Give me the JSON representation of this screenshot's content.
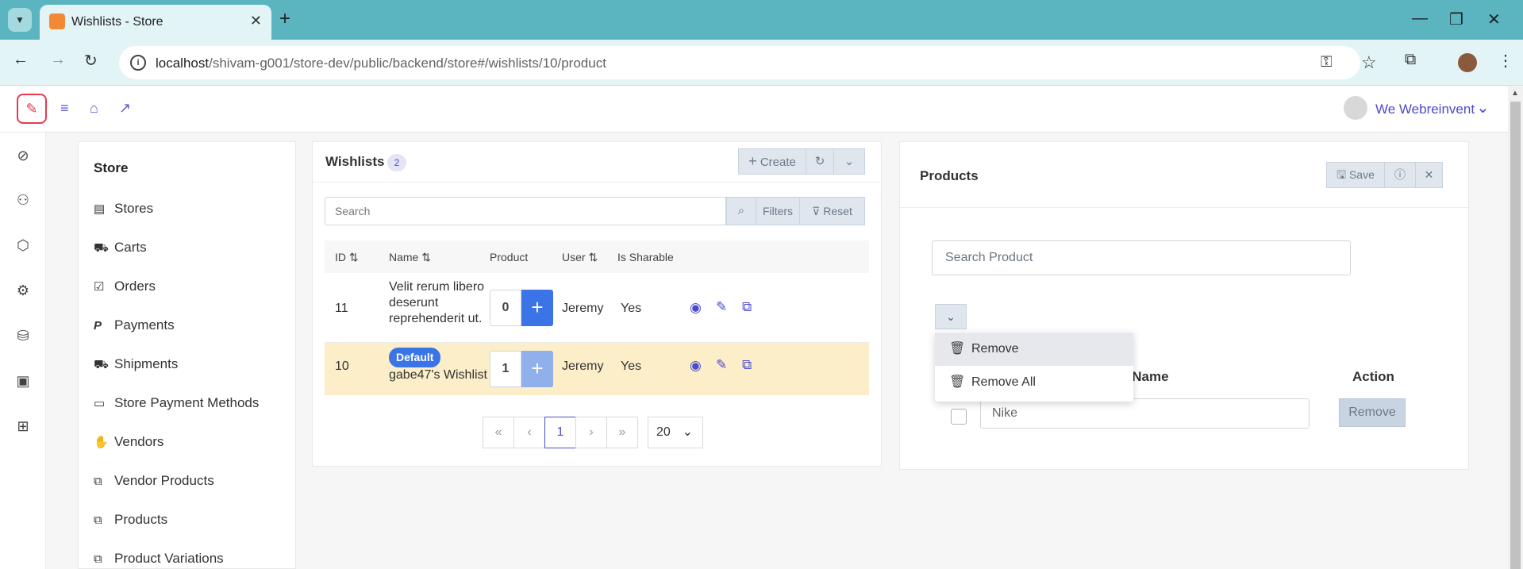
{
  "browser": {
    "tab_title": "Wishlists - Store",
    "url_host": "localhost",
    "url_path": "/shivam-g001/store-dev/public/backend/store#/wishlists/10/product"
  },
  "header": {
    "user_name": "We Webreinvent"
  },
  "store_nav": {
    "title": "Store",
    "items": [
      {
        "label": "Stores",
        "icon": "building-icon"
      },
      {
        "label": "Carts",
        "icon": "cart-icon"
      },
      {
        "label": "Orders",
        "icon": "checkbox-icon"
      },
      {
        "label": "Payments",
        "icon": "paypal-icon"
      },
      {
        "label": "Shipments",
        "icon": "truck-icon"
      },
      {
        "label": "Store Payment Methods",
        "icon": "credit-card-icon"
      },
      {
        "label": "Vendors",
        "icon": "handshake-icon"
      },
      {
        "label": "Vendor Products",
        "icon": "copy-icon"
      },
      {
        "label": "Products",
        "icon": "copy-icon"
      },
      {
        "label": "Product Variations",
        "icon": "copy-icon"
      }
    ]
  },
  "wishlists": {
    "title": "Wishlists",
    "count": "2",
    "create_label": "Create",
    "search_placeholder": "Search",
    "filters_label": "Filters",
    "reset_label": "Reset",
    "columns": [
      "ID",
      "Name",
      "Product",
      "User",
      "Is Sharable"
    ],
    "rows": [
      {
        "id": "11",
        "name_line1": "Velit rerum libero",
        "name_line2": "deserunt",
        "name_line3": "reprehenderit ut.",
        "product_count": "0",
        "user": "Jeremy",
        "sharable": "Yes"
      },
      {
        "id": "10",
        "badge": "Default",
        "name_line1": "gabe47's Wishlist",
        "product_count": "1",
        "user": "Jeremy",
        "sharable": "Yes"
      }
    ],
    "pager": {
      "current_page": "1",
      "page_size": "20"
    }
  },
  "products": {
    "title": "Products",
    "save_label": "Save",
    "search_placeholder": "Search Product",
    "col_name_visible": "uct Name",
    "col_action": "Action",
    "row_name": "Nike",
    "row_remove_label": "Remove",
    "bulk_menu": [
      {
        "label": "Remove"
      },
      {
        "label": "Remove All"
      }
    ]
  }
}
